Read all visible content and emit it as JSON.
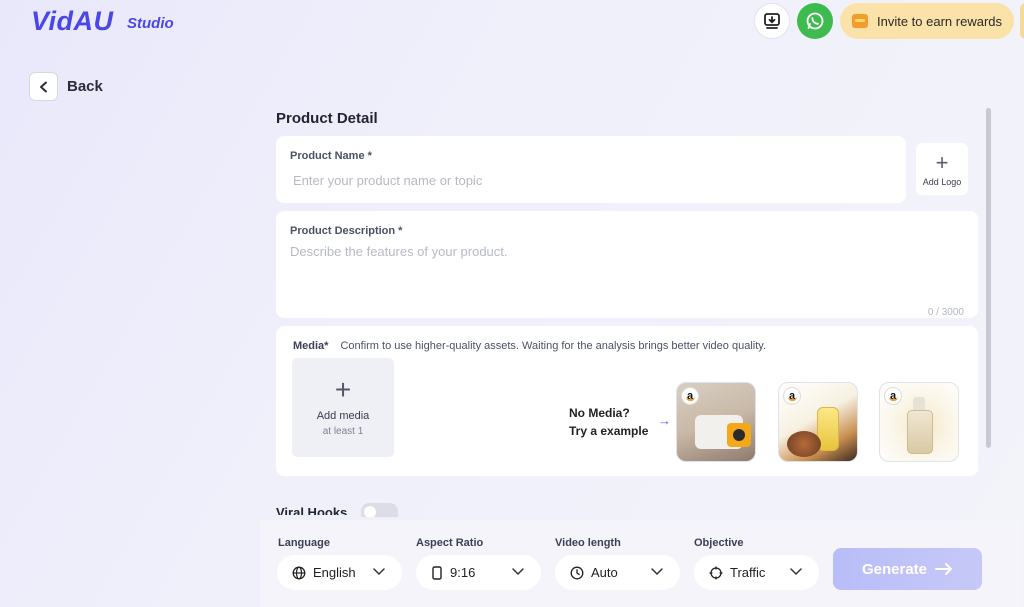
{
  "header": {
    "logo": "VidAU",
    "studio": "Studio",
    "invite_label": "Invite to earn rewards"
  },
  "nav": {
    "back_label": "Back"
  },
  "product_detail": {
    "title": "Product Detail",
    "name_label": "Product Name *",
    "name_placeholder": "Enter your product name or topic",
    "add_logo_label": "Add Logo",
    "desc_label": "Product Description *",
    "desc_placeholder": "Describe the features of your product.",
    "desc_counter": "0 / 3000"
  },
  "media": {
    "label": "Media*",
    "hint": "Confirm to use higher-quality assets. Waiting for the analysis brings better video quality.",
    "add_label": "Add media",
    "add_sub": "at least 1",
    "no_media_line1": "No Media?",
    "no_media_line2": "Try a example",
    "examples": [
      "projector",
      "oil-sprayer",
      "serum"
    ]
  },
  "viral_hooks": {
    "label": "Viral Hooks",
    "enabled": false
  },
  "options": {
    "language": {
      "label": "Language",
      "value": "English"
    },
    "aspect": {
      "label": "Aspect Ratio",
      "value": "9:16"
    },
    "length": {
      "label": "Video length",
      "value": "Auto"
    },
    "objective": {
      "label": "Objective",
      "value": "Traffic"
    }
  },
  "generate_label": "Generate",
  "colors": {
    "brand": "#4a47e8",
    "invite_bg": "#fbe2a8",
    "whatsapp": "#3dbb4f",
    "generate_bg": "#bcc0f8"
  }
}
